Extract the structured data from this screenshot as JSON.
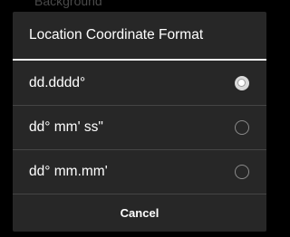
{
  "background": {
    "partial_text": "Background"
  },
  "dialog": {
    "title": "Location Coordinate Format",
    "options": [
      {
        "label": "dd.dddd°",
        "selected": true
      },
      {
        "label": "dd° mm' ss\"",
        "selected": false
      },
      {
        "label": "dd° mm.mm'",
        "selected": false
      }
    ],
    "cancel_label": "Cancel"
  },
  "colors": {
    "dialog_bg": "#272727",
    "title_divider": "#f2f2f2",
    "row_divider": "#454545",
    "text": "#ffffff"
  },
  "icons": {
    "selected": "radio-checked-icon",
    "unselected": "radio-unchecked-icon"
  }
}
